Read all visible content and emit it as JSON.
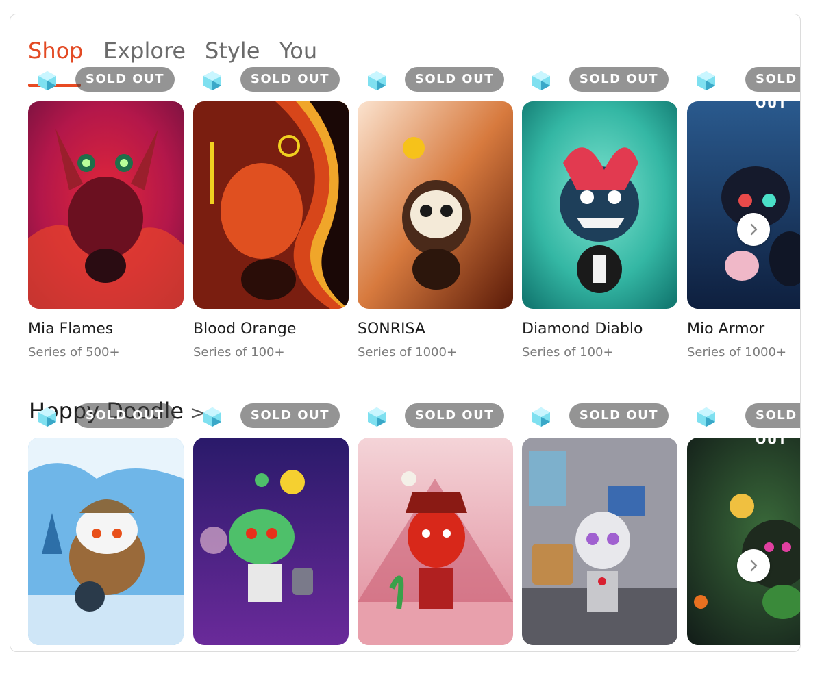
{
  "tabs": [
    {
      "label": "Shop",
      "active": true
    },
    {
      "label": "Explore",
      "active": false
    },
    {
      "label": "Style",
      "active": false
    },
    {
      "label": "You",
      "active": false
    }
  ],
  "featured": {
    "items": [
      {
        "name": "Mia Flames",
        "series": "Series of 500+",
        "badge": "SOLD OUT"
      },
      {
        "name": "Blood Orange",
        "series": "Series of 100+",
        "badge": "SOLD OUT"
      },
      {
        "name": "SONRISA",
        "series": "Series of 1000+",
        "badge": "SOLD OUT"
      },
      {
        "name": "Diamond Diablo",
        "series": "Series of 100+",
        "badge": "SOLD OUT"
      },
      {
        "name": "Mio Armor",
        "series": "Series of 1000+",
        "badge": "SOLD OUT"
      }
    ]
  },
  "section": {
    "title": "Hoppy Doodle",
    "chevron": ">",
    "items": [
      {
        "badge": "SOLD OUT"
      },
      {
        "badge": "SOLD OUT"
      },
      {
        "badge": "SOLD OUT"
      },
      {
        "badge": "SOLD OUT"
      },
      {
        "badge": "SOLD OUT"
      }
    ]
  },
  "icons": {
    "collectible": "gem-icon",
    "carousel_next": "chevron-right-icon"
  },
  "colors": {
    "accent": "#e34a24",
    "badge_bg": "#3c3c3c"
  }
}
